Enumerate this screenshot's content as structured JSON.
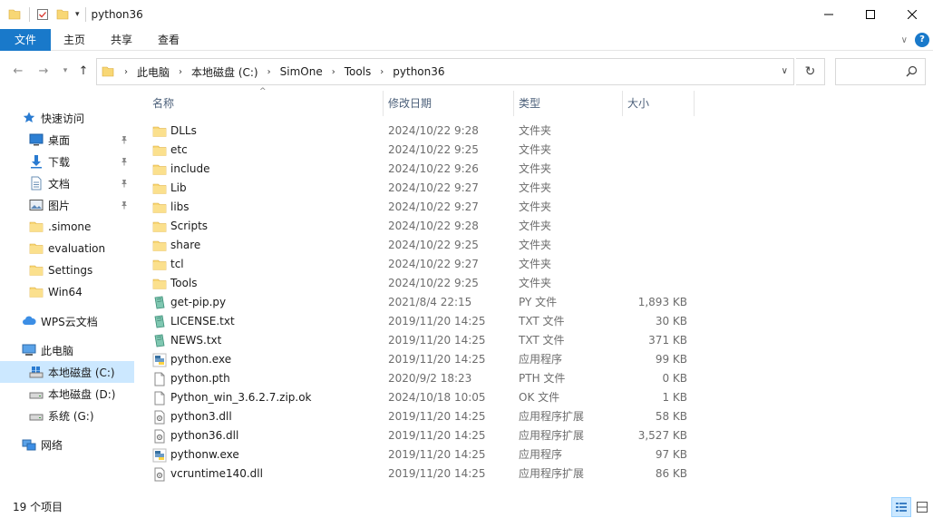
{
  "window": {
    "title": "python36"
  },
  "ribbon": {
    "tabs": [
      "文件",
      "主页",
      "共享",
      "查看"
    ]
  },
  "address": {
    "crumbs": [
      "此电脑",
      "本地磁盘 (C:)",
      "SimOne",
      "Tools",
      "python36"
    ]
  },
  "sidebar": {
    "items": [
      {
        "label": "快速访问",
        "icon": "star-icon",
        "indent": 1,
        "pinned": false,
        "selected": false
      },
      {
        "label": "桌面",
        "icon": "desktop-icon",
        "indent": 2,
        "pinned": true,
        "selected": false
      },
      {
        "label": "下载",
        "icon": "download-icon",
        "indent": 2,
        "pinned": true,
        "selected": false
      },
      {
        "label": "文档",
        "icon": "document-icon",
        "indent": 2,
        "pinned": true,
        "selected": false
      },
      {
        "label": "图片",
        "icon": "picture-icon",
        "indent": 2,
        "pinned": true,
        "selected": false
      },
      {
        "label": ".simone",
        "icon": "folder-icon",
        "indent": 2,
        "pinned": false,
        "selected": false
      },
      {
        "label": "evaluation",
        "icon": "folder-icon",
        "indent": 2,
        "pinned": false,
        "selected": false
      },
      {
        "label": "Settings",
        "icon": "folder-icon",
        "indent": 2,
        "pinned": false,
        "selected": false
      },
      {
        "label": "Win64",
        "icon": "folder-icon",
        "indent": 2,
        "pinned": false,
        "selected": false
      },
      {
        "label": "WPS云文档",
        "icon": "cloud-icon",
        "indent": 1,
        "pinned": false,
        "selected": false
      },
      {
        "label": "此电脑",
        "icon": "computer-icon",
        "indent": 1,
        "pinned": false,
        "selected": false
      },
      {
        "label": "本地磁盘 (C:)",
        "icon": "system-drive-icon",
        "indent": 2,
        "pinned": false,
        "selected": true
      },
      {
        "label": "本地磁盘 (D:)",
        "icon": "drive-icon",
        "indent": 2,
        "pinned": false,
        "selected": false
      },
      {
        "label": "系统 (G:)",
        "icon": "drive-icon",
        "indent": 2,
        "pinned": false,
        "selected": false
      },
      {
        "label": "网络",
        "icon": "network-icon",
        "indent": 1,
        "pinned": false,
        "selected": false
      }
    ]
  },
  "columns": {
    "name": "名称",
    "date": "修改日期",
    "type": "类型",
    "size": "大小"
  },
  "files": [
    {
      "name": "DLLs",
      "date": "2024/10/22 9:28",
      "type": "文件夹",
      "size": "",
      "icon": "folder-icon"
    },
    {
      "name": "etc",
      "date": "2024/10/22 9:25",
      "type": "文件夹",
      "size": "",
      "icon": "folder-icon"
    },
    {
      "name": "include",
      "date": "2024/10/22 9:26",
      "type": "文件夹",
      "size": "",
      "icon": "folder-icon"
    },
    {
      "name": "Lib",
      "date": "2024/10/22 9:27",
      "type": "文件夹",
      "size": "",
      "icon": "folder-icon"
    },
    {
      "name": "libs",
      "date": "2024/10/22 9:27",
      "type": "文件夹",
      "size": "",
      "icon": "folder-icon"
    },
    {
      "name": "Scripts",
      "date": "2024/10/22 9:28",
      "type": "文件夹",
      "size": "",
      "icon": "folder-icon"
    },
    {
      "name": "share",
      "date": "2024/10/22 9:25",
      "type": "文件夹",
      "size": "",
      "icon": "folder-icon"
    },
    {
      "name": "tcl",
      "date": "2024/10/22 9:27",
      "type": "文件夹",
      "size": "",
      "icon": "folder-icon"
    },
    {
      "name": "Tools",
      "date": "2024/10/22 9:25",
      "type": "文件夹",
      "size": "",
      "icon": "folder-icon"
    },
    {
      "name": "get-pip.py",
      "date": "2021/8/4 22:15",
      "type": "PY 文件",
      "size": "1,893 KB",
      "icon": "notepad-file-icon"
    },
    {
      "name": "LICENSE.txt",
      "date": "2019/11/20 14:25",
      "type": "TXT 文件",
      "size": "30 KB",
      "icon": "notepad-file-icon"
    },
    {
      "name": "NEWS.txt",
      "date": "2019/11/20 14:25",
      "type": "TXT 文件",
      "size": "371 KB",
      "icon": "notepad-file-icon"
    },
    {
      "name": "python.exe",
      "date": "2019/11/20 14:25",
      "type": "应用程序",
      "size": "99 KB",
      "icon": "python-exe-icon"
    },
    {
      "name": "python.pth",
      "date": "2020/9/2 18:23",
      "type": "PTH 文件",
      "size": "0 KB",
      "icon": "blank-file-icon"
    },
    {
      "name": "Python_win_3.6.2.7.zip.ok",
      "date": "2024/10/18 10:05",
      "type": "OK 文件",
      "size": "1 KB",
      "icon": "blank-file-icon"
    },
    {
      "name": "python3.dll",
      "date": "2019/11/20 14:25",
      "type": "应用程序扩展",
      "size": "58 KB",
      "icon": "dll-file-icon"
    },
    {
      "name": "python36.dll",
      "date": "2019/11/20 14:25",
      "type": "应用程序扩展",
      "size": "3,527 KB",
      "icon": "dll-file-icon"
    },
    {
      "name": "pythonw.exe",
      "date": "2019/11/20 14:25",
      "type": "应用程序",
      "size": "97 KB",
      "icon": "python-exe-icon"
    },
    {
      "name": "vcruntime140.dll",
      "date": "2019/11/20 14:25",
      "type": "应用程序扩展",
      "size": "86 KB",
      "icon": "dll-file-icon"
    }
  ],
  "status": {
    "item_count": "19 个项目"
  },
  "colors": {
    "accent": "#1979ca",
    "selected": "#cce8ff",
    "folder": "#f8d775",
    "header_text": "#4c607a"
  }
}
